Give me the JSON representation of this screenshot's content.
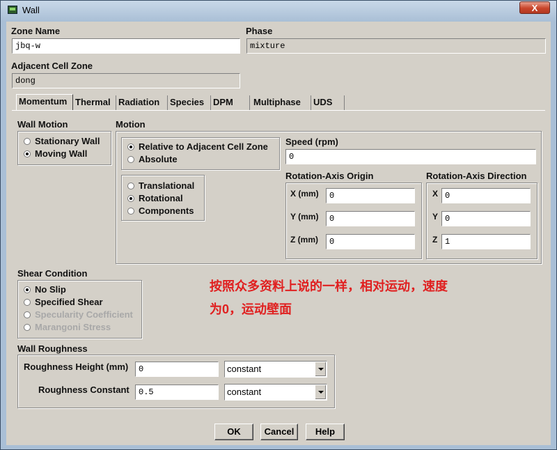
{
  "window": {
    "title": "Wall",
    "close_label": "X"
  },
  "zone_name": {
    "label": "Zone Name",
    "value": "jbq-w"
  },
  "phase": {
    "label": "Phase",
    "value": "mixture"
  },
  "adjacent_cell_zone": {
    "label": "Adjacent Cell Zone",
    "value": "dong"
  },
  "tabs": [
    "Momentum",
    "Thermal",
    "Radiation",
    "Species",
    "DPM",
    "Multiphase",
    "UDS"
  ],
  "wall_motion": {
    "label": "Wall Motion",
    "options": [
      "Stationary Wall",
      "Moving Wall"
    ],
    "selected": "Moving Wall"
  },
  "motion": {
    "label": "Motion",
    "reference": {
      "options": [
        "Relative to Adjacent Cell Zone",
        "Absolute"
      ],
      "selected": "Relative to Adjacent Cell Zone"
    },
    "type": {
      "options": [
        "Translational",
        "Rotational",
        "Components"
      ],
      "selected": "Rotational"
    },
    "speed": {
      "label": "Speed (rpm)",
      "value": "0"
    },
    "axis_origin": {
      "label": "Rotation-Axis Origin",
      "x_label": "X (mm)",
      "x": "0",
      "y_label": "Y (mm)",
      "y": "0",
      "z_label": "Z (mm)",
      "z": "0"
    },
    "axis_direction": {
      "label": "Rotation-Axis Direction",
      "x_label": "X",
      "x": "0",
      "y_label": "Y",
      "y": "0",
      "z_label": "Z",
      "z": "1"
    }
  },
  "shear_condition": {
    "label": "Shear Condition",
    "options": [
      "No Slip",
      "Specified Shear",
      "Specularity Coefficient",
      "Marangoni Stress"
    ],
    "selected": "No Slip"
  },
  "wall_roughness": {
    "label": "Wall Roughness",
    "height": {
      "label": "Roughness Height (mm)",
      "value": "0",
      "method": "constant"
    },
    "constant": {
      "label": "Roughness Constant",
      "value": "0.5",
      "method": "constant"
    }
  },
  "annotation": {
    "line1": "按照众多资料上说的一样，相对运动，速度",
    "line2": "为0，运动壁面",
    "color": "#e02020"
  },
  "buttons": {
    "ok": "OK",
    "cancel": "Cancel",
    "help": "Help"
  }
}
